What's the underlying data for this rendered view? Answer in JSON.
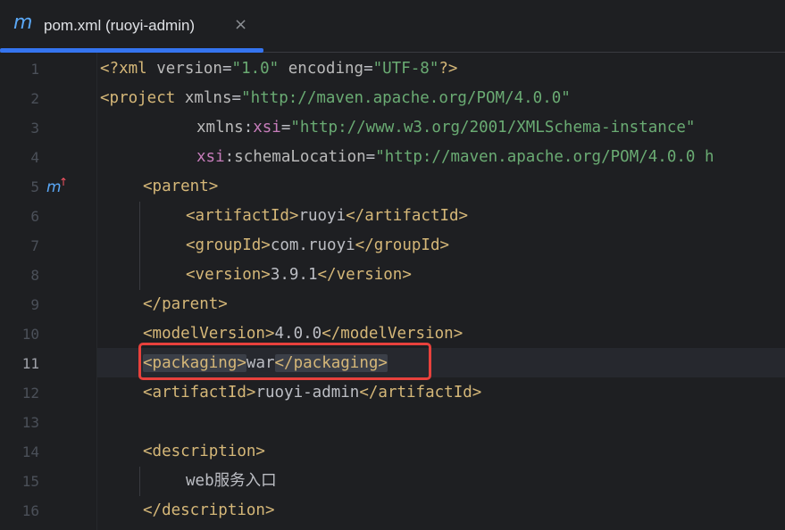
{
  "tab": {
    "icon": "maven-m-icon",
    "icon_glyph": "m",
    "title": "pom.xml (ruoyi-admin)",
    "close_glyph": "×",
    "accent_color": "#3574f0"
  },
  "editor": {
    "current_line": 11,
    "line_numbers": [
      "1",
      "2",
      "3",
      "4",
      "5",
      "6",
      "7",
      "8",
      "9",
      "10",
      "11",
      "12",
      "13",
      "14",
      "15",
      "16"
    ],
    "gutter_marker": {
      "line": 5,
      "icon": "maven-parent-override-icon",
      "glyph": "m",
      "arrow": "↑"
    },
    "highlight_box_color": "#e8413c",
    "lines": {
      "l1": {
        "open": "<?xml ",
        "attr1": "version",
        "eq1": "=",
        "val1": "\"1.0\"",
        "sp": " ",
        "attr2": "encoding",
        "eq2": "=",
        "val2": "\"UTF-8\"",
        "close": "?>"
      },
      "l2": {
        "open": "<project ",
        "attr": "xmlns",
        "eq": "=",
        "val": "\"http://maven.apache.org/POM/4.0.0\""
      },
      "l3": {
        "attr": "xmlns",
        "colon": ":",
        "ns": "xsi",
        "eq": "=",
        "val": "\"http://www.w3.org/2001/XMLSchema-instance\""
      },
      "l4": {
        "ns": "xsi",
        "colon": ":",
        "attr": "schemaLocation",
        "eq": "=",
        "val": "\"http://maven.apache.org/POM/4.0.0 h"
      },
      "l5": {
        "tag": "<parent>"
      },
      "l6": {
        "open": "<artifactId>",
        "text": "ruoyi",
        "close": "</artifactId>"
      },
      "l7": {
        "open": "<groupId>",
        "text": "com.ruoyi",
        "close": "</groupId>"
      },
      "l8": {
        "open": "<version>",
        "text": "3.9.1",
        "close": "</version>"
      },
      "l9": {
        "tag": "</parent>"
      },
      "l10": {
        "open": "<modelVersion>",
        "text": "4.0.0",
        "close": "</modelVersion>"
      },
      "l11": {
        "open": "<packaging>",
        "text": "war",
        "close": "</packaging>"
      },
      "l12": {
        "open": "<artifactId>",
        "text": "ruoyi-admin",
        "close": "</artifactId>"
      },
      "l13": {},
      "l14": {
        "tag": "<description>"
      },
      "l15": {
        "text": "web服务入口"
      },
      "l16": {
        "tag": "</description>"
      }
    }
  }
}
